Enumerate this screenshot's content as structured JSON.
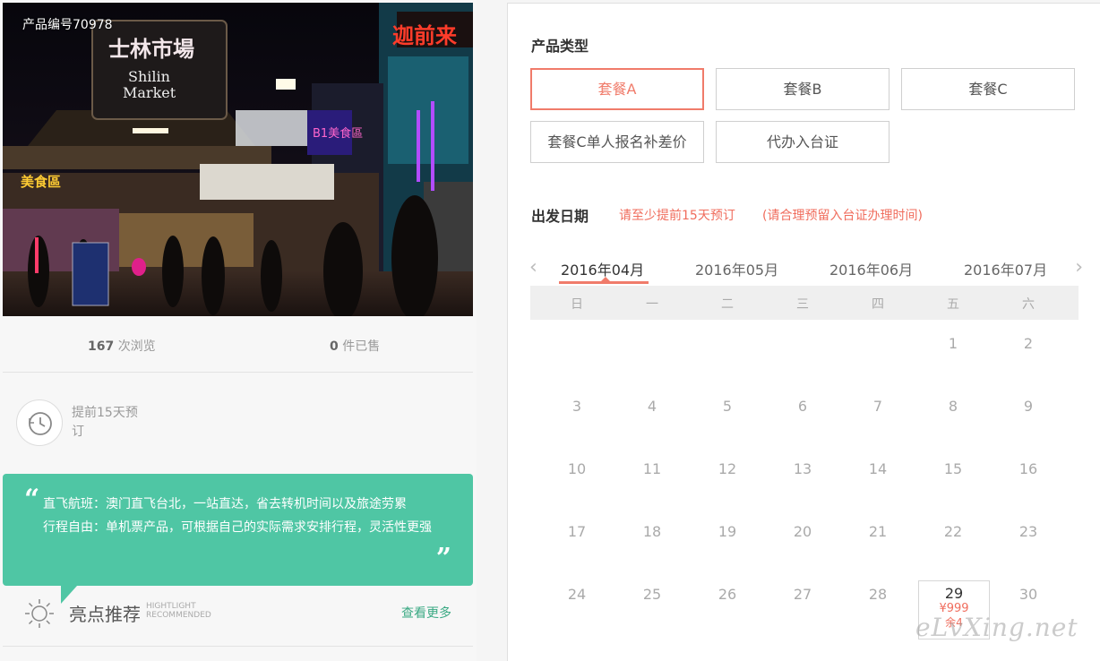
{
  "product": {
    "code_label": "产品编号70978",
    "views_count": "167",
    "views_label": "次浏览",
    "sold_count": "0",
    "sold_label": "件已售",
    "advance_text": "提前15天预订"
  },
  "hero_image": {
    "sign_cn": "士林市場",
    "sign_en_1": "Shilin",
    "sign_en_2": "Market",
    "side_sign": "迦前来",
    "neon_1": "B1美食區",
    "neon_2": "美食區"
  },
  "quote": {
    "line1": "直飞航班：澳门直飞台北，一站直达，省去转机时间以及旅途劳累",
    "line2": "行程自由：单机票产品，可根据自己的实际需求安排行程，灵活性更强",
    "open": "“",
    "close": "”"
  },
  "highlight": {
    "title": "亮点推荐",
    "en_1": "HIGHTLIGHT",
    "en_2": "RECOMMENDED",
    "more": "查看更多"
  },
  "booking": {
    "package_title": "产品类型",
    "packages": [
      "套餐A",
      "套餐B",
      "套餐C",
      "套餐C单人报名补差价",
      "代办入台证"
    ],
    "date_title": "出发日期",
    "note1": "请至少提前15天预订",
    "note2": "(请合理预留入台证办理时间)",
    "arrow_left": "‹",
    "arrow_right": "›",
    "months": [
      "2016年04月",
      "2016年05月",
      "2016年06月",
      "2016年07月"
    ],
    "weekdays": [
      "日",
      "一",
      "二",
      "三",
      "四",
      "五",
      "六"
    ],
    "days": [
      "1",
      "2",
      "3",
      "4",
      "5",
      "6",
      "7",
      "8",
      "9",
      "10",
      "11",
      "12",
      "13",
      "14",
      "15",
      "16",
      "17",
      "18",
      "19",
      "20",
      "21",
      "22",
      "23",
      "24",
      "25",
      "26",
      "27",
      "28",
      "29",
      "30"
    ],
    "selected_price": "¥999",
    "selected_left": "余4"
  },
  "watermark": "eLvXing.net",
  "colors": {
    "accent": "#f07b6a",
    "quote_bg": "#4fc6a4",
    "link_green": "#3aa983"
  }
}
